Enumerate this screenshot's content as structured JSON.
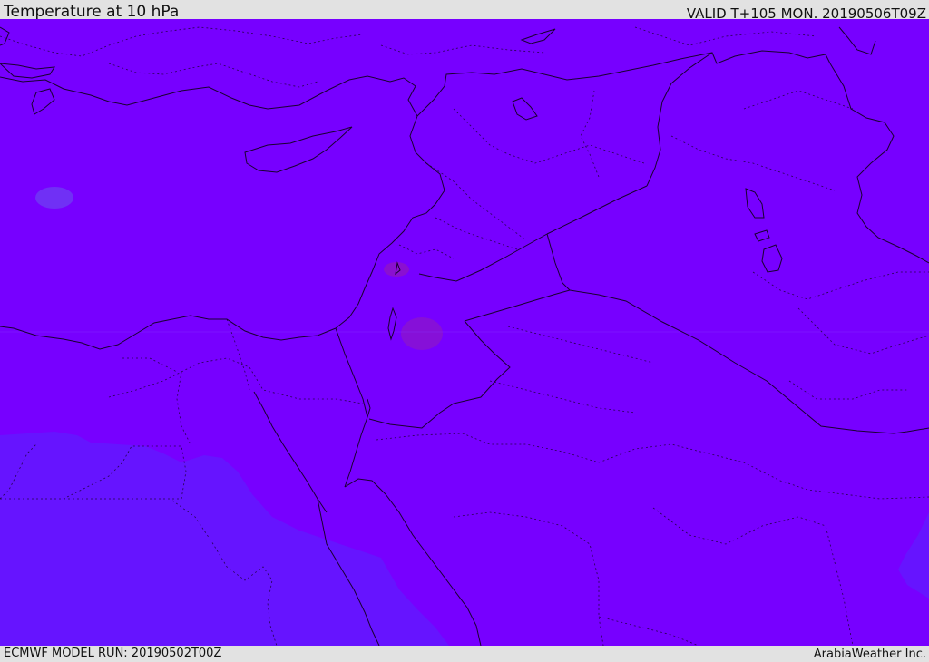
{
  "header": {
    "title": "Temperature at 10 hPa",
    "valid": "VALID T+105 MON. 20190506T09Z"
  },
  "footer": {
    "model_run": "ECMWF MODEL RUN: 20190502T00Z",
    "credit": "ArabiaWeather Inc."
  },
  "colors": {
    "field_main": "#7700ff",
    "field_cool": "#6614ff",
    "field_blob_light": "#7030f5",
    "field_blob_warm": "#7a0ae0",
    "field_blob_dark": "#8610d8",
    "borders": "#1a0030"
  }
}
